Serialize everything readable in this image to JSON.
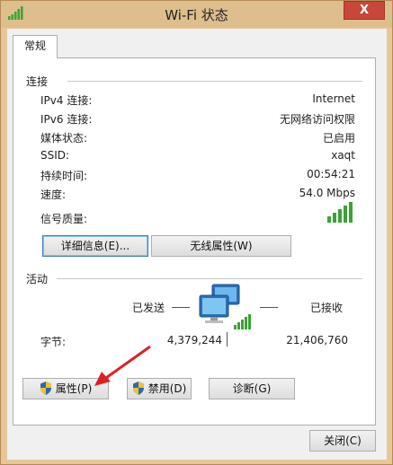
{
  "window": {
    "title": "Wi-Fi 状态",
    "close_label": "X"
  },
  "tabs": [
    {
      "label": "常规",
      "selected": true
    }
  ],
  "connection": {
    "group_title": "连接",
    "rows": [
      {
        "label": "IPv4 连接:",
        "value": "Internet"
      },
      {
        "label": "IPv6 连接:",
        "value": "无网络访问权限"
      },
      {
        "label": "媒体状态:",
        "value": "已启用"
      },
      {
        "label": "SSID:",
        "value": "xaqt"
      },
      {
        "label": "持续时间:",
        "value": "00:54:21"
      },
      {
        "label": "速度:",
        "value": "54.0 Mbps"
      }
    ],
    "signal_label": "信号质量:",
    "signal_level": "5 of 5 bars",
    "details_button": "详细信息(E)...",
    "wireless_button": "无线属性(W)"
  },
  "activity": {
    "group_title": "活动",
    "sent_label": "已发送",
    "received_label": "已接收",
    "bytes_label": "字节:",
    "bytes_sent": "4,379,244",
    "bytes_received": "21,406,760"
  },
  "actions": {
    "properties_button": "属性(P)",
    "disable_button": "禁用(D)",
    "diagnose_button": "诊断(G)"
  },
  "footer": {
    "close_button": "关闭(C)"
  },
  "colors": {
    "signal_green": "#3aa335",
    "annotation_arrow": "#e02020",
    "focus_border": "#3c7fb1"
  },
  "icons": {
    "title": "wifi-signal-icon",
    "network": "network-computers-icon",
    "shield": "uac-shield-icon"
  }
}
